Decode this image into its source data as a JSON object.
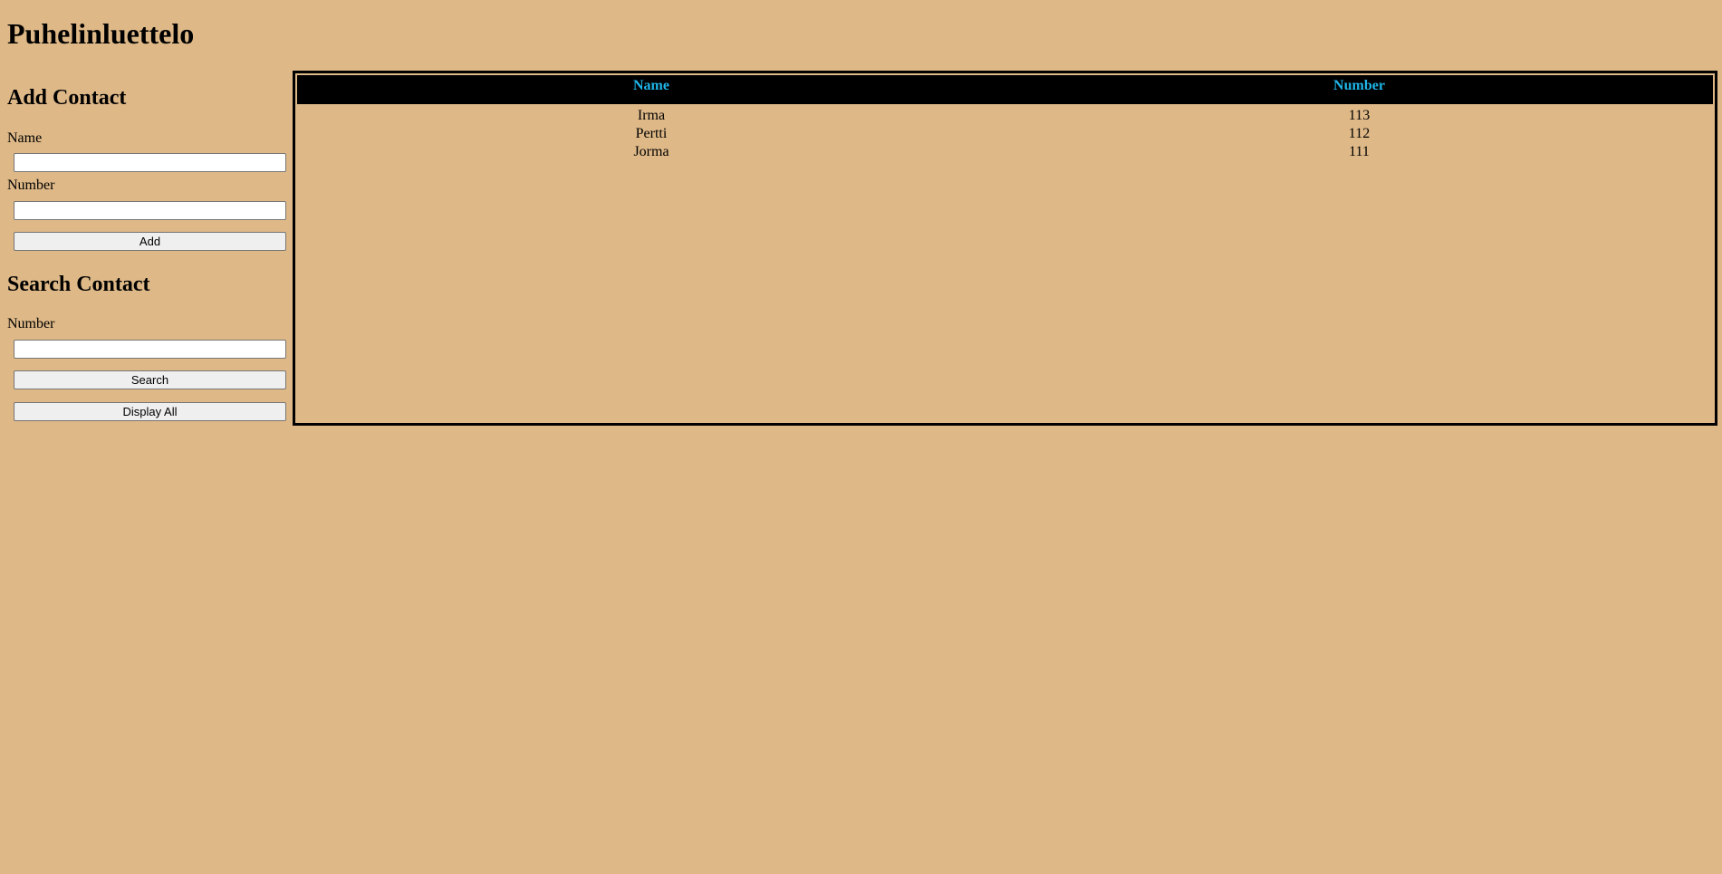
{
  "app": {
    "title": "Puhelinluettelo"
  },
  "add_contact": {
    "heading": "Add Contact",
    "name_label": "Name",
    "name_value": "",
    "number_label": "Number",
    "number_value": "",
    "add_label": "Add"
  },
  "search_contact": {
    "heading": "Search Contact",
    "number_label": "Number",
    "number_value": "",
    "search_label": "Search",
    "display_all_label": "Display All"
  },
  "table": {
    "headers": {
      "name": "Name",
      "number": "Number"
    },
    "rows": [
      {
        "name": "Irma",
        "number": "113"
      },
      {
        "name": "Pertti",
        "number": "112"
      },
      {
        "name": "Jorma",
        "number": "111"
      }
    ]
  },
  "colors": {
    "background": "#deb887",
    "header_text": "#1fb5e8",
    "header_background": "#000000"
  }
}
